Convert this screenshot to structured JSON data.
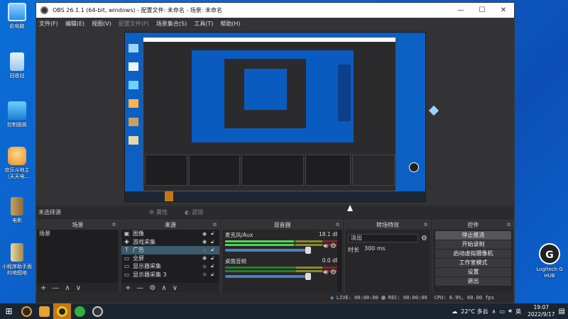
{
  "desktop": {
    "icons": [
      {
        "label": "此电脑"
      },
      {
        "label": "回收站"
      },
      {
        "label": "控制面板"
      },
      {
        "label": "欢乐斗地主（天天电..."
      },
      {
        "label": "电影"
      },
      {
        "label": "小程序助手面的地图地"
      }
    ],
    "right_icon": {
      "label": "Logitech G HUB",
      "glyph": "G"
    }
  },
  "window": {
    "title": "OBS 26.1.1 (64-bit, windows) - 配置文件: 未命名 - 场景: 未命名",
    "controls": [
      "—",
      "☐",
      "✕"
    ],
    "menu": [
      {
        "label": "文件(F)",
        "enabled": true
      },
      {
        "label": "编辑(E)",
        "enabled": true
      },
      {
        "label": "视图(V)",
        "enabled": true
      },
      {
        "label": "配置文件(P)",
        "enabled": false
      },
      {
        "label": "场景集合(S)",
        "enabled": true
      },
      {
        "label": "工具(T)",
        "enabled": true
      },
      {
        "label": "帮助(H)",
        "enabled": true
      }
    ]
  },
  "source_toolbar": {
    "no_source": "未选择源",
    "properties": "属性",
    "filters": "滤镜"
  },
  "docks": {
    "scenes": {
      "title": "场景",
      "items": [
        "场景"
      ]
    },
    "sources": {
      "title": "来源",
      "items": [
        {
          "name": "图像",
          "icon": "image-icon",
          "glyph": "▣",
          "selected": false
        },
        {
          "name": "游戏采集",
          "icon": "gamepad-icon",
          "glyph": "✚",
          "selected": false
        },
        {
          "name": "广告",
          "icon": "text-icon",
          "glyph": "T",
          "selected": true
        },
        {
          "name": "全屏",
          "icon": "monitor-icon",
          "glyph": "▭",
          "selected": false
        },
        {
          "name": "显示器采集",
          "icon": "monitor-icon",
          "glyph": "▭",
          "selected": false
        },
        {
          "name": "显示器采集 3",
          "icon": "monitor-icon",
          "glyph": "▭",
          "selected": false
        }
      ]
    },
    "mixer": {
      "title": "混音器",
      "channels": [
        {
          "name": "麦克风/Aux",
          "db": "18.1 dB",
          "active": true
        },
        {
          "name": "桌面音频",
          "db": "0.0 dB",
          "active": false
        }
      ]
    },
    "transitions": {
      "title": "转场特效",
      "selected": "淡出",
      "duration_label": "时长",
      "duration": "300 ms"
    },
    "controls": {
      "title": "控件",
      "buttons": [
        "停止推流",
        "开始录制",
        "启动虚拟摄像机",
        "工作室模式",
        "设置",
        "退出"
      ]
    }
  },
  "status": {
    "live": "LIVE: 00:00:00",
    "rec": "REC: 00:00:00",
    "cpu": "CPU: 0.9%, 60.00 fps"
  },
  "taskbar": {
    "weather": "22°C 多云",
    "ime": "英",
    "time": "19:07",
    "date": "2022/9/17"
  }
}
